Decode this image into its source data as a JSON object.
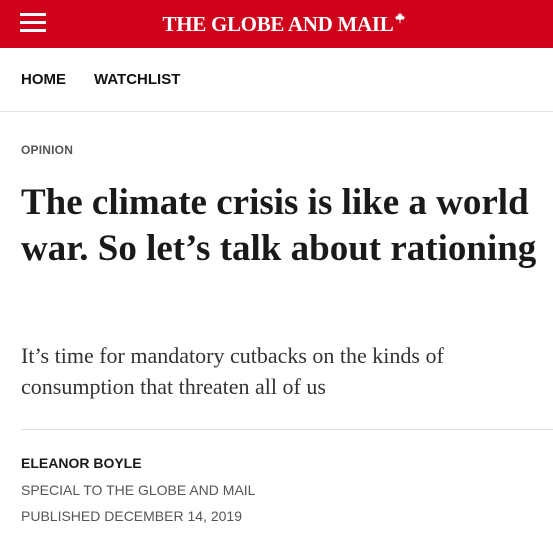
{
  "header": {
    "logo_text": "THE GLOBE AND MAIL",
    "brand_color": "#d0021b",
    "menu_icon": "hamburger-menu-icon",
    "logo_icon": "maple-leaf-icon"
  },
  "nav": {
    "items": [
      {
        "label": "HOME"
      },
      {
        "label": "WATCHLIST"
      }
    ]
  },
  "article": {
    "section": "OPINION",
    "headline": "The climate crisis is like a world war. So let’s talk about rationing",
    "dek": "It’s time for mandatory cutbacks on the kinds of consumption that threaten all of us",
    "author": "ELEANOR BOYLE",
    "author_role": "SPECIAL TO THE GLOBE AND MAIL",
    "published": "PUBLISHED DECEMBER 14, 2019"
  }
}
